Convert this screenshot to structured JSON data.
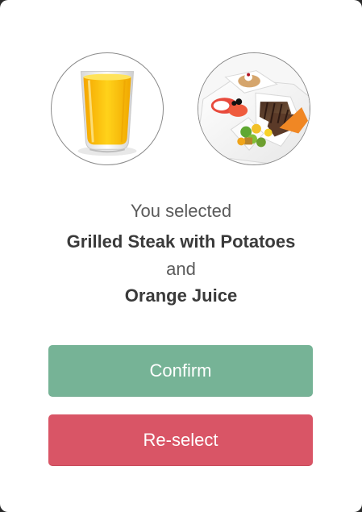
{
  "dialog": {
    "selection_intro": "You selected",
    "selected_meal": "Grilled Steak with Potatoes",
    "conjunction": "and",
    "selected_drink": "Orange Juice"
  },
  "images": {
    "drink_icon": "orange-juice-glass",
    "meal_icon": "grilled-steak-plate"
  },
  "buttons": {
    "confirm": "Confirm",
    "reselect": "Re-select"
  },
  "colors": {
    "confirm": "#76b396",
    "reselect": "#d95566",
    "text": "#3d3d3d"
  }
}
